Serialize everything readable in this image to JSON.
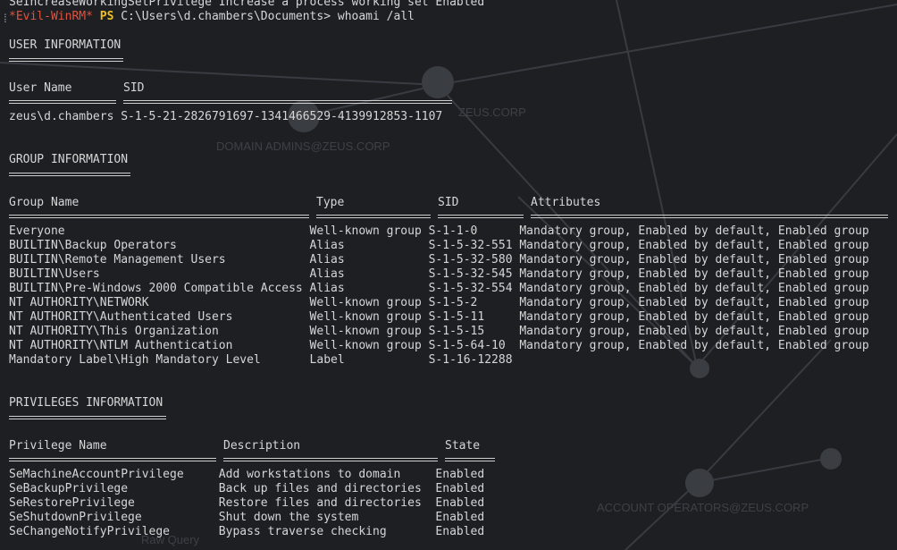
{
  "terminal": {
    "scroll_line": "SeIncreaseWorkingSetPrivilege Increase a process working set Enabled",
    "prompt": {
      "host": "*Evil-WinRM*",
      "shell": "PS",
      "path": "C:\\Users\\d.chambers\\Documents>",
      "command": "whoami /all"
    },
    "user_information": {
      "title": "USER INFORMATION",
      "headers": [
        "User Name",
        "SID"
      ],
      "rows": [
        "zeus\\d.chambers S-1-5-21-2826791697-1341466529-4139912853-1107"
      ]
    },
    "group_information": {
      "title": "GROUP INFORMATION",
      "headers": [
        "Group Name",
        "Type",
        "SID",
        "Attributes"
      ],
      "rows": [
        "Everyone                                   Well-known group S-1-1-0      Mandatory group, Enabled by default, Enabled group",
        "BUILTIN\\Backup Operators                   Alias            S-1-5-32-551 Mandatory group, Enabled by default, Enabled group",
        "BUILTIN\\Remote Management Users            Alias            S-1-5-32-580 Mandatory group, Enabled by default, Enabled group",
        "BUILTIN\\Users                              Alias            S-1-5-32-545 Mandatory group, Enabled by default, Enabled group",
        "BUILTIN\\Pre-Windows 2000 Compatible Access Alias            S-1-5-32-554 Mandatory group, Enabled by default, Enabled group",
        "NT AUTHORITY\\NETWORK                       Well-known group S-1-5-2      Mandatory group, Enabled by default, Enabled group",
        "NT AUTHORITY\\Authenticated Users           Well-known group S-1-5-11     Mandatory group, Enabled by default, Enabled group",
        "NT AUTHORITY\\This Organization             Well-known group S-1-5-15     Mandatory group, Enabled by default, Enabled group",
        "NT AUTHORITY\\NTLM Authentication           Well-known group S-1-5-64-10  Mandatory group, Enabled by default, Enabled group",
        "Mandatory Label\\High Mandatory Level       Label            S-1-16-12288"
      ]
    },
    "privileges_information": {
      "title": "PRIVILEGES INFORMATION",
      "headers": [
        "Privilege Name",
        "Description",
        "State"
      ],
      "rows": [
        "SeMachineAccountPrivilege     Add workstations to domain     Enabled",
        "SeBackupPrivilege             Back up files and directories  Enabled",
        "SeRestorePrivilege            Restore files and directories  Enabled",
        "SeShutdownPrivilege           Shut down the system           Enabled",
        "SeChangeNotifyPrivilege       Bypass traverse checking       Enabled"
      ]
    }
  },
  "background_graph": {
    "labels": [
      "DOMAIN ADMINS@ZEUS.CORP",
      "ZEUS.CORP",
      "ACCOUNT OPERATORS@ZEUS.CORP",
      "Raw Query"
    ],
    "line_color": "#3a3d43",
    "node_color": "#3a3d42"
  }
}
